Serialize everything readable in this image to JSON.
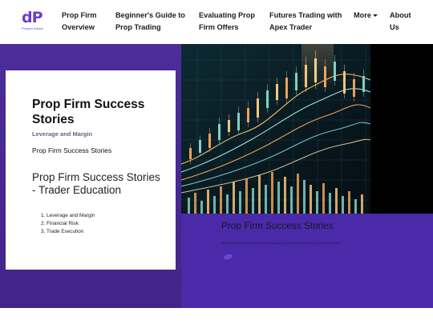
{
  "header": {
    "logo_mark": "dP",
    "logo_sub": "Prosper Advice",
    "nav": {
      "overview": "Prop Firm Overview",
      "guide": "Beginner's Guide to Prop Trading",
      "evaluating": "Evaluating Prop Firm Offers",
      "futures": "Futures Trading with Apex Trader",
      "more": "More",
      "about": "About Us"
    }
  },
  "card": {
    "title": "Prop Firm Success Stories",
    "subtitle": "Leverage and Margin",
    "text": "Prop Firm Success Stories",
    "heading": "Prop Firm Success Stories - Trader Education",
    "list": [
      "Leverage and Margin",
      "Financial Risk",
      "Trade Execution"
    ]
  },
  "panel": {
    "title": "Prop Firm Success Stories",
    "url": "https://prodeaadvice.com/ the-beginners-guide-to-prop-trading/prop-firm-success-stories.html",
    "logo_mark": "dP"
  },
  "colors": {
    "brand": "#6c3bd6",
    "hero_bg": "#4b2a9c",
    "panel_bg": "#4a2aa8"
  }
}
